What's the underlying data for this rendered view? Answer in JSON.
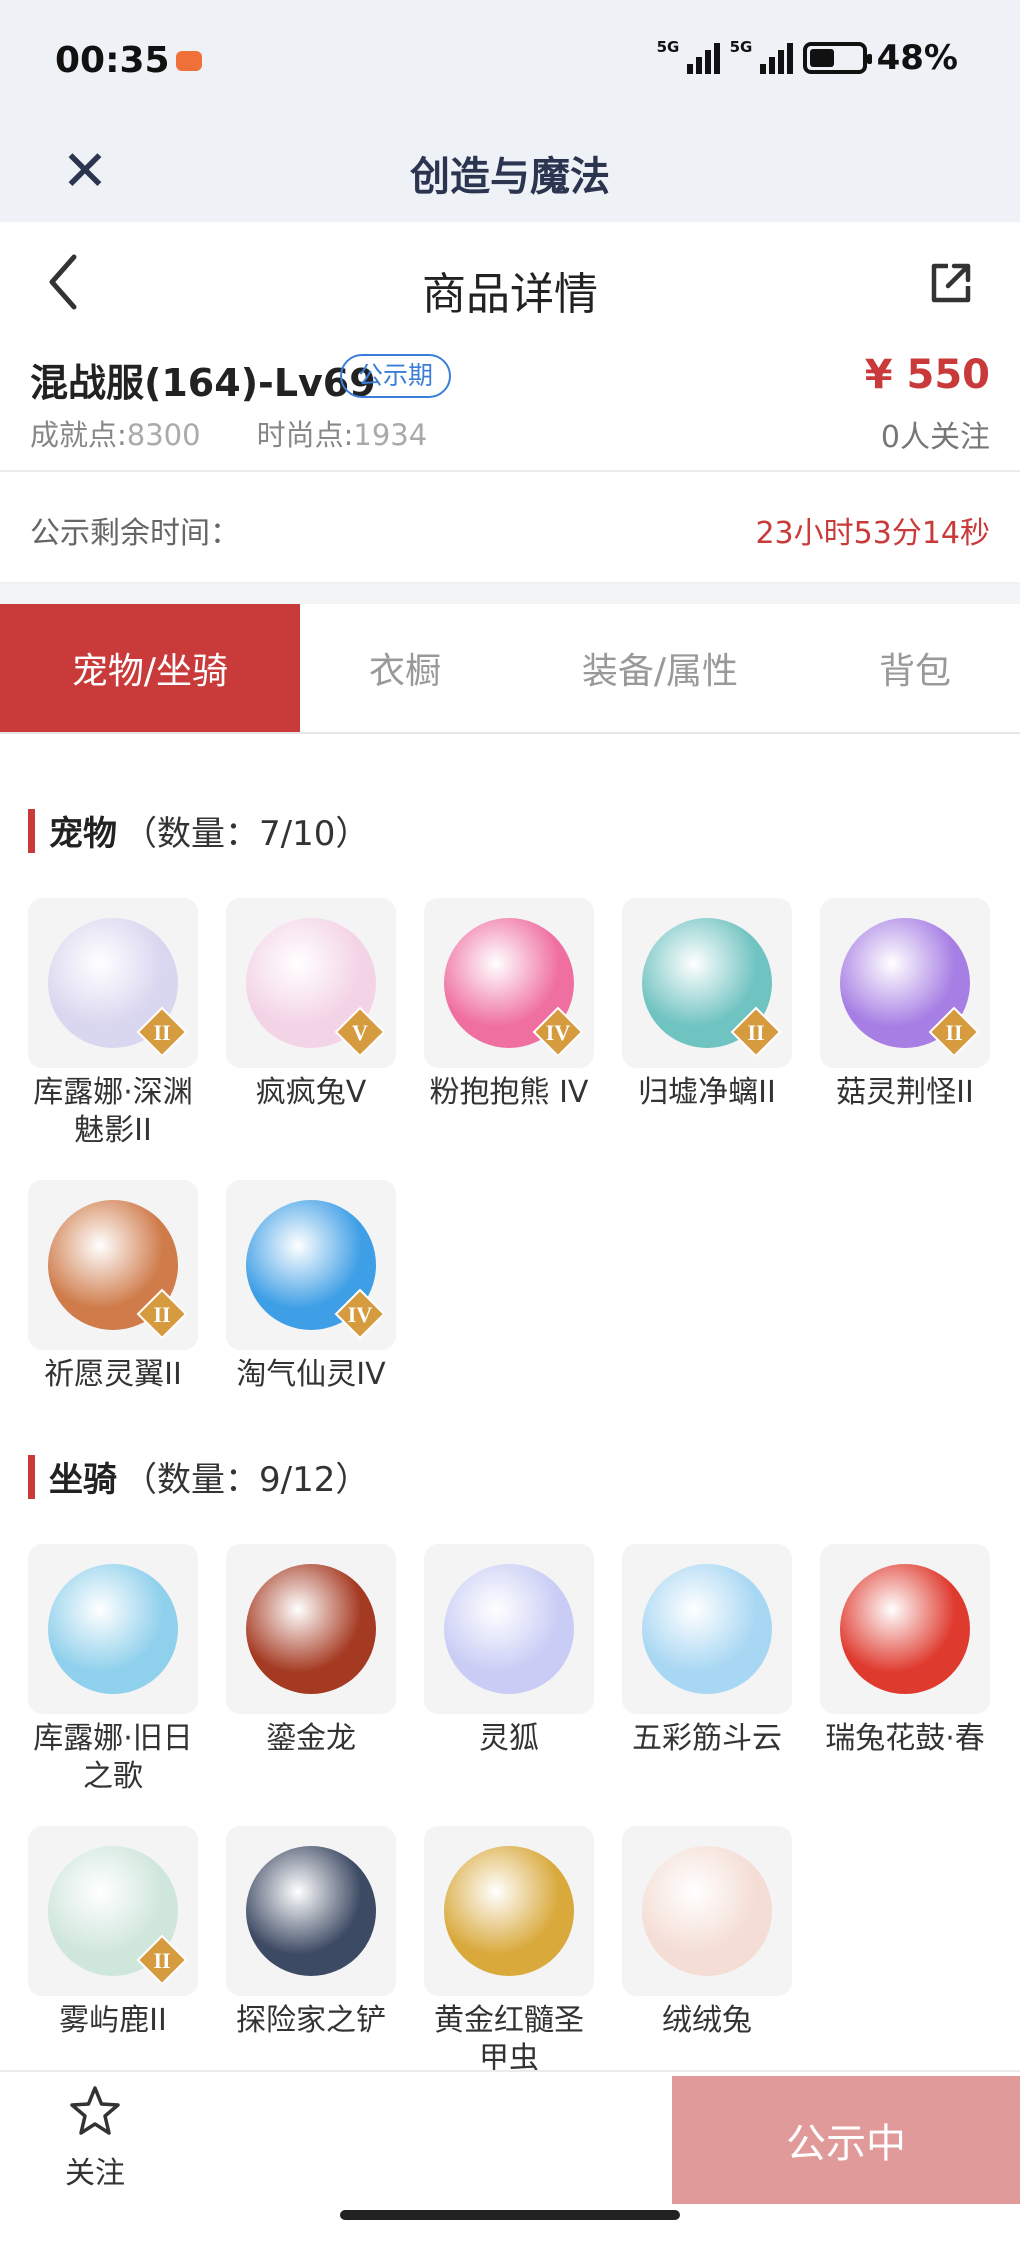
{
  "status_bar": {
    "time": "00:35",
    "network_1": "5G",
    "network_2": "5G",
    "battery": "48%",
    "battery_level": 0.48
  },
  "app_header": {
    "title": "创造与魔法"
  },
  "nav": {
    "title": "商品详情"
  },
  "product": {
    "name": "混战服(164)-Lv69",
    "badge": "公示期",
    "price": "¥ 550",
    "followers": "0人关注",
    "stat1_label": "成就点:",
    "stat1_value": "8300",
    "stat2_label": "时尚点:",
    "stat2_value": "1934"
  },
  "countdown": {
    "label": "公示剩余时间：",
    "value": "23小时53分14秒"
  },
  "tabs": [
    "宠物/坐骑",
    "衣橱",
    "装备/属性",
    "背包"
  ],
  "pets": {
    "name": "宠物",
    "count": "（数量：7/10）",
    "items": [
      {
        "name": "库露娜·深渊魅影II",
        "grade": "II",
        "color": "#d9d6ef"
      },
      {
        "name": "疯疯兔V",
        "grade": "V",
        "color": "#f3d3e6"
      },
      {
        "name": "粉抱抱熊 IV",
        "grade": "IV",
        "color": "#ef6fa1"
      },
      {
        "name": "归墟净螭II",
        "grade": "II",
        "color": "#6fc3c1"
      },
      {
        "name": "菇灵荆怪II",
        "grade": "II",
        "color": "#a77fe4"
      },
      {
        "name": "祈愿灵翼II",
        "grade": "II",
        "color": "#cf7b4a"
      },
      {
        "name": "淘气仙灵IV",
        "grade": "IV",
        "color": "#3f9fe6"
      }
    ]
  },
  "mounts": {
    "name": "坐骑",
    "count": "（数量：9/12）",
    "items": [
      {
        "name": "库露娜·旧日之歌",
        "color": "#8fd0ec"
      },
      {
        "name": "鎏金龙",
        "color": "#a53a22"
      },
      {
        "name": "灵狐",
        "color": "#c9cdf5"
      },
      {
        "name": "五彩筋斗云",
        "color": "#a8d7f3"
      },
      {
        "name": "瑞兔花鼓·春",
        "color": "#df3a2e"
      },
      {
        "name": "雾屿鹿II",
        "grade": "II",
        "color": "#cfe6dc"
      },
      {
        "name": "探险家之铲",
        "color": "#3d4a63"
      },
      {
        "name": "黄金红髓圣甲虫",
        "color": "#d9a93c"
      },
      {
        "name": "绒绒兔",
        "color": "#f4ddd4"
      }
    ]
  },
  "bottom": {
    "follow": "关注",
    "status": "公示中"
  }
}
